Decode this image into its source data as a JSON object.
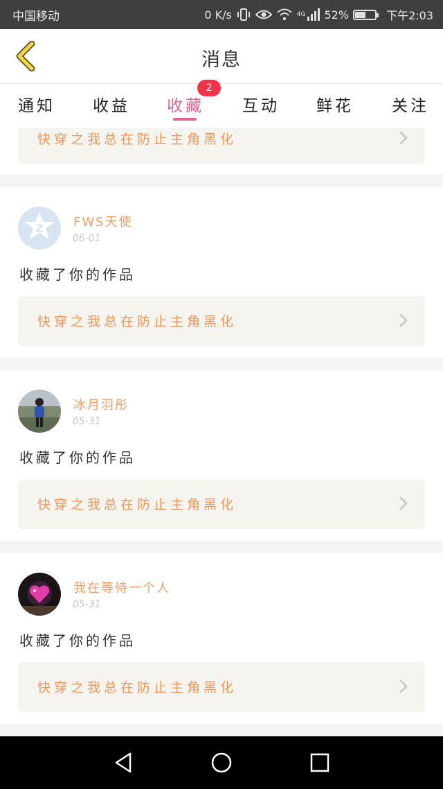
{
  "status_bar": {
    "carrier": "中国移动",
    "speed": "0 K/s",
    "network": "4G",
    "battery_percent": "52%",
    "battery_level": 0.52,
    "time": "下午2:03"
  },
  "header": {
    "title": "消息"
  },
  "tabs": [
    {
      "label": "通知",
      "active": false
    },
    {
      "label": "收益",
      "active": false
    },
    {
      "label": "收藏",
      "active": true,
      "badge": "2"
    },
    {
      "label": "互动",
      "active": false
    },
    {
      "label": "鲜花",
      "active": false
    },
    {
      "label": "关注",
      "active": false
    }
  ],
  "colors": {
    "accent": "#e06496",
    "badge": "#f2334a",
    "work_title": "#f0975e",
    "user_name": "#f0a06a"
  },
  "feed": {
    "top_partial": {
      "work_title": "快穿之我总在防止主角黑化"
    },
    "items": [
      {
        "user_name": "FWS天使",
        "date": "06-01",
        "action": "收藏了你的作品",
        "work_title": "快穿之我总在防止主角黑化",
        "avatar": "default-avatar-icon"
      },
      {
        "user_name": "冰月羽彤",
        "date": "05-31",
        "action": "收藏了你的作品",
        "work_title": "快穿之我总在防止主角黑化",
        "avatar": "photo-avatar"
      },
      {
        "user_name": "我在等待一个人",
        "date": "05-31",
        "action": "收藏了你的作品",
        "work_title": "快穿之我总在防止主角黑化",
        "avatar": "heart-avatar"
      }
    ]
  },
  "nav_bar": {
    "buttons": [
      "back-triangle-icon",
      "home-circle-icon",
      "recents-square-icon"
    ]
  }
}
